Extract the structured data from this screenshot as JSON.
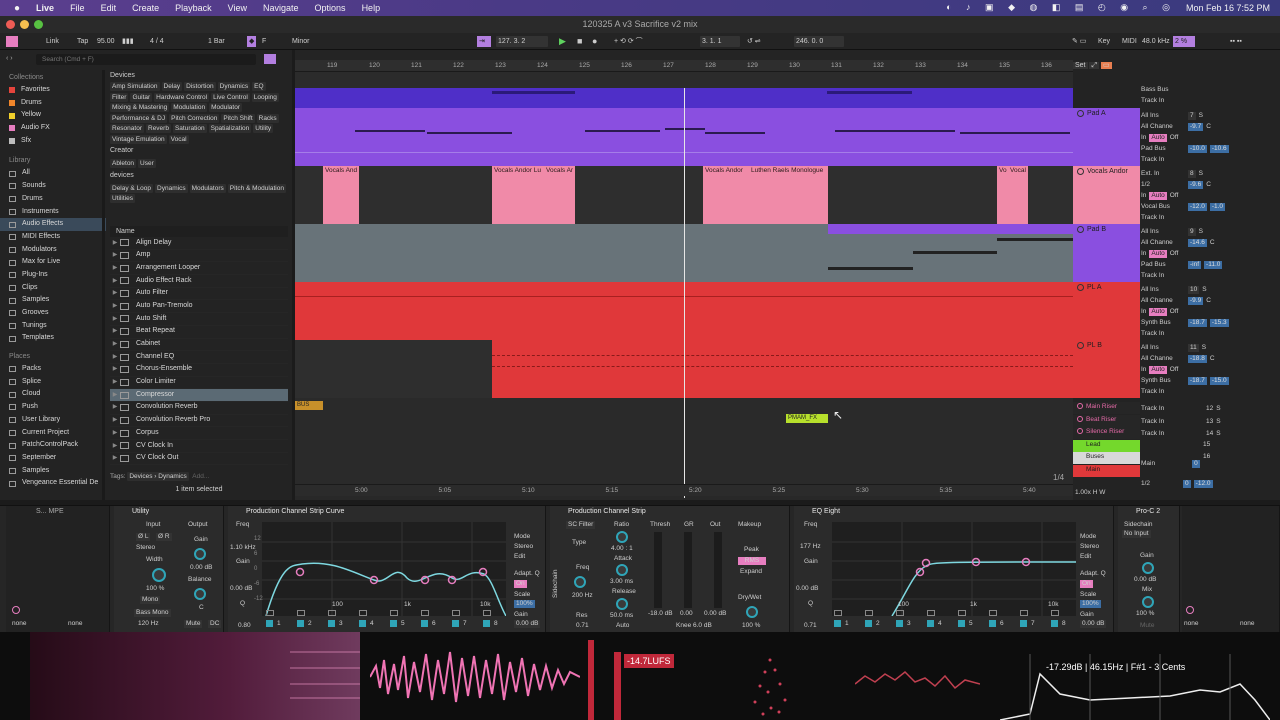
{
  "menubar": {
    "app": "Live",
    "items": [
      "File",
      "Edit",
      "Create",
      "Playback",
      "View",
      "Navigate",
      "Options",
      "Help"
    ],
    "datetime": "Mon Feb 16  7:52 PM"
  },
  "window": {
    "title": "120325 A v3 Sacrifice v2 mix"
  },
  "transport": {
    "link": "Link",
    "tap": "Tap",
    "tempo": "95.00",
    "sig": "4 / 4",
    "quant": "1 Bar",
    "key_root": "F",
    "key_scale": "Minor",
    "pos": "127.   3.   2",
    "loop_start": "3.   1.   1",
    "loop_len": "246.   0.   0",
    "key_btn": "Key",
    "midi": "MIDI",
    "sample_rate": "48.0 kHz",
    "cpu": "2 %"
  },
  "browser": {
    "search_placeholder": "Search (Cmd + F)",
    "collections_title": "Collections",
    "collections": [
      {
        "label": "Favorites",
        "color": "#e5443c"
      },
      {
        "label": "Drums",
        "color": "#f0862b"
      },
      {
        "label": "Yellow",
        "color": "#f0cf2b"
      },
      {
        "label": "Audio FX",
        "color": "#e77ec0"
      },
      {
        "label": "Sfx",
        "color": "#bdbdbd"
      }
    ],
    "library_title": "Library",
    "library": [
      "All",
      "Sounds",
      "Drums",
      "Instruments",
      "Audio Effects",
      "MIDI Effects",
      "Modulators",
      "Max for Live",
      "Plug-Ins",
      "Clips",
      "Samples",
      "Grooves",
      "Tunings",
      "Templates"
    ],
    "places_title": "Places",
    "places": [
      "Packs",
      "Splice",
      "Cloud",
      "Push",
      "User Library",
      "Current Project",
      "PatchControlPack",
      "September",
      "Samples",
      "Vengeance Essential De"
    ],
    "filter_devices_label": "Devices",
    "filter_devices": [
      "Amp Simulation",
      "Delay",
      "Distortion",
      "Dynamics",
      "EQ",
      "Filter",
      "Guitar",
      "Hardware Control",
      "Live Control",
      "Looping",
      "Mixing & Mastering",
      "Modulation",
      "Modulator",
      "Performance & DJ",
      "Pitch Correction",
      "Pitch Shift",
      "Racks",
      "Resonator",
      "Reverb",
      "Saturation",
      "Spatialization",
      "Utility",
      "Vintage Emulation",
      "Vocal"
    ],
    "filter_creator_label": "Creator",
    "filter_creator": [
      "Ableton",
      "User"
    ],
    "filter_dev2_label": "devices",
    "filter_dev2": [
      "Delay & Loop",
      "Dynamics",
      "Modulators",
      "Pitch & Modulation",
      "Utilities"
    ],
    "name_header": "Name",
    "files": [
      "Align Delay",
      "Amp",
      "Arrangement Looper",
      "Audio Effect Rack",
      "Auto Filter",
      "Auto Pan-Tremolo",
      "Auto Shift",
      "Beat Repeat",
      "Cabinet",
      "Channel EQ",
      "Chorus-Ensemble",
      "Color Limiter",
      "Compressor",
      "Convolution Reverb",
      "Convolution Reverb Pro",
      "Corpus",
      "CV Clock In",
      "CV Clock Out"
    ],
    "tags_label": "Tags:",
    "tags_path": "Devices › Dynamics",
    "tags_add": "Add...",
    "selected_info": "1 item selected"
  },
  "ruler": {
    "bars": [
      "119",
      "120",
      "121",
      "122",
      "123",
      "124",
      "125",
      "126",
      "127",
      "128",
      "129",
      "130",
      "131",
      "132",
      "133",
      "134",
      "135",
      "136"
    ],
    "times": [
      "5:00",
      "5:05",
      "5:10",
      "5:15",
      "5:20",
      "5:25",
      "5:30",
      "5:35",
      "5:40"
    ],
    "set_btn": "Set",
    "page": "1/4"
  },
  "clips": {
    "vocal_titles": [
      "Vocals And",
      "Vocals Andor  Lu",
      "Vocals Ar",
      "Vocals Andor",
      "Luthen Raels Monologue",
      "Vo",
      "Vocal"
    ],
    "bus_locator": "BUS",
    "fx_locator": "PMAM_FX"
  },
  "tracks": [
    {
      "name": "Pad A",
      "color": "#8a4fe0",
      "in": "All Ins",
      "ch": "All Channe",
      "vol": "-9.7",
      "pan": "C",
      "num": "7",
      "out": "Pad Bus",
      "s1": "-10.0",
      "s2": "-10.6"
    },
    {
      "name": "Vocals Andor",
      "color": "#f08aa8",
      "in": "Ext. In",
      "ch": "1/2",
      "vol": "-9.6",
      "pan": "C",
      "num": "8",
      "out": "Vocal Bus",
      "s1": "-12.0",
      "s2": "-1.0"
    },
    {
      "name": "Pad B",
      "color": "#8a4fe0",
      "in": "All Ins",
      "ch": "All Channe",
      "vol": "-14.6",
      "pan": "C",
      "num": "9",
      "out": "Pad Bus",
      "s1": "-inf",
      "s2": "-11.0"
    },
    {
      "name": "PL A",
      "color": "#e0383a",
      "in": "All Ins",
      "ch": "All Channe",
      "vol": "-9.9",
      "pan": "C",
      "num": "10",
      "out": "Synth Bus",
      "s1": "-18.7",
      "s2": "-15.3"
    },
    {
      "name": "PL B",
      "color": "#e0383a",
      "in": "All Ins",
      "ch": "All Channe",
      "vol": "-18.8",
      "pan": "C",
      "num": "11",
      "out": "Synth Bus",
      "s1": "-18.7",
      "s2": "-15.0"
    }
  ],
  "small_tracks": [
    {
      "name": "Main Riser",
      "num": "12",
      "color": "#e66aa8"
    },
    {
      "name": "Beat Riser",
      "num": "13",
      "color": "#e66aa8"
    },
    {
      "name": "Silence Riser",
      "num": "14",
      "color": "#e66aa8"
    },
    {
      "name": "Lead",
      "num": "15",
      "color": "#74d82c"
    },
    {
      "name": "Buses",
      "num": "16",
      "color": "#d8d8d8"
    },
    {
      "name": "Main",
      "num": "",
      "color": "#e0383a"
    }
  ],
  "mixer_top": {
    "bass_bus": "Bass Bus",
    "track_in": "Track In",
    "in_label": "In",
    "auto": "Auto",
    "off": "Off",
    "main": "Main",
    "main_ch": "1/2",
    "main_vol": "0",
    "main_val": "-12.0",
    "zoom": "1.00x"
  },
  "devices": {
    "utility": {
      "title": "Utility",
      "input": "Input",
      "output": "Output",
      "phase_l": "Ø L",
      "phase_r": "Ø R",
      "mode": "Stereo",
      "width_label": "Width",
      "width": "100 %",
      "mono": "Mono",
      "bass_mono": "Bass Mono",
      "bass_freq": "120 Hz",
      "mute": "Mute",
      "dc": "DC",
      "gain_label": "Gain",
      "gain": "0.00 dB",
      "balance_label": "Balance",
      "balance": "C"
    },
    "pcs_curve": {
      "title": "Production Channel Strip Curve",
      "freq_label": "Freq",
      "freq": "1.10 kHz",
      "gain_label": "Gain",
      "gain": "0.00 dB",
      "q_label": "Q",
      "q": "0.80",
      "axis": [
        "100",
        "1k",
        "10k"
      ],
      "db": [
        "12",
        "6",
        "0",
        "-6",
        "-12"
      ],
      "mode_label": "Mode",
      "mode": "Stereo",
      "edit": "Edit",
      "adapt": "Adapt. Q",
      "on": "On",
      "scale_label": "Scale",
      "scale": "100%",
      "gain2_label": "Gain",
      "gain2": "0.00 dB",
      "bands": [
        "1",
        "2",
        "3",
        "4",
        "5",
        "6",
        "7",
        "8"
      ]
    },
    "pcs": {
      "title": "Production Channel Strip",
      "sc": "SC Filter",
      "type_label": "Type",
      "freq_label": "Freq",
      "freq": "200 Hz",
      "res_label": "Res",
      "res": "0.71",
      "ratio_label": "Ratio",
      "ratio": "4.00 : 1",
      "attack_label": "Attack",
      "attack": "3.00 ms",
      "release_label": "Release",
      "release": "50.0 ms",
      "release_mode": "Auto",
      "thresh": "Thresh",
      "gr": "GR",
      "out": "Out",
      "thresh_val": "-18.0 dB",
      "gr_val": "0.00",
      "out_val": "0.00 dB",
      "knee": "Knee  6.0 dB",
      "makeup": "Makeup",
      "peak": "Peak",
      "rms": "RMS",
      "expand": "Expand",
      "drywet_label": "Dry/Wet",
      "drywet": "100 %",
      "sidechain": "Sidechain"
    },
    "eq8": {
      "title": "EQ Eight",
      "freq_label": "Freq",
      "freq": "177 Hz",
      "gain_label": "Gain",
      "gain": "0.00 dB",
      "q_label": "Q",
      "q": "0.71",
      "axis": [
        "100",
        "1k",
        "10k"
      ],
      "mode_label": "Mode",
      "mode": "Stereo",
      "edit": "Edit",
      "adapt": "Adapt. Q",
      "on": "On",
      "scale_label": "Scale",
      "scale": "100%",
      "gain2_label": "Gain",
      "gain2": "0.00 dB",
      "bands": [
        "1",
        "2",
        "3",
        "4",
        "5",
        "6",
        "7",
        "8"
      ]
    },
    "proc2": {
      "title": "Pro-C 2",
      "sidechain": "Sidechain",
      "sc_value": "No Input",
      "gain_label": "Gain",
      "gain": "0.00 dB",
      "mix_label": "Mix",
      "mix": "100 %",
      "mute": "Mute"
    },
    "chain_none": [
      "none",
      "none",
      "none",
      "none"
    ]
  },
  "visualizer": {
    "loudness": "-14.7LUFS",
    "spectrum_readout": "-17.29dB | 46.15Hz | F#1 - 3 Cents"
  }
}
